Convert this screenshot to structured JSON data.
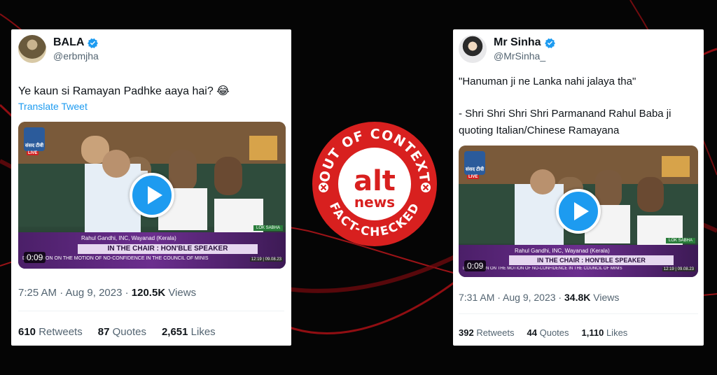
{
  "colors": {
    "twitter_blue": "#1d9bf0",
    "badge_red": "#d8201f",
    "background": "#050505"
  },
  "tweet_left": {
    "display_name": "BALA",
    "handle": "@erbmjha",
    "verified": true,
    "text": "Ye kaun si Ramayan Padhke aaya hai? 😂",
    "translate": "Translate Tweet",
    "video": {
      "duration": "0:09",
      "lower_third_name": "Rahul Gandhi, INC, Wayanad (Kerala)",
      "lower_third_chair": "IN THE CHAIR : HON'BLE SPEAKER",
      "lower_third_discussion": "DISCUSSION ON THE MOTION OF NO-CONFIDENCE IN THE COUNCIL OF MINIS",
      "tag": "LOK SABHA",
      "timestamp": "12:19 | 09.08.23",
      "channel": "संसद टीवी",
      "live": "LIVE"
    },
    "time": "7:25 AM · Aug 9, 2023 · ",
    "views_count": "120.5K",
    "views_label": " Views",
    "retweets_count": "610",
    "retweets_label": " Retweets",
    "quotes_count": "87",
    "quotes_label": " Quotes",
    "likes_count": "2,651",
    "likes_label": " Likes"
  },
  "tweet_right": {
    "display_name": "Mr Sinha",
    "handle": "@MrSinha_",
    "verified": true,
    "text_line1": "\"Hanuman ji ne Lanka nahi jalaya tha\"",
    "text_line2": "- Shri Shri Shri Shri Parmanand Rahul Baba ji",
    "text_line3": "quoting Italian/Chinese Ramayana",
    "video": {
      "duration": "0:09",
      "lower_third_name": "Rahul Gandhi, INC, Wayanad (Kerala)",
      "lower_third_chair": "IN THE CHAIR : HON'BLE SPEAKER",
      "lower_third_discussion": "DISCUSSION ON THE MOTION OF NO-CONFIDENCE IN THE COUNCIL OF MINIS",
      "tag": "LOK SABHA",
      "timestamp": "12:19 | 09.08.23",
      "channel": "संसद टीवी",
      "live": "LIVE"
    },
    "time": "7:31 AM · Aug 9, 2023 · ",
    "views_count": "34.8K",
    "views_label": " Views",
    "retweets_count": "392",
    "retweets_label": " Retweets",
    "quotes_count": "44",
    "quotes_label": " Quotes",
    "likes_count": "1,110",
    "likes_label": " Likes"
  },
  "badge": {
    "top_text": "OUT OF CONTEXT",
    "bottom_text": "FACT-CHECKED",
    "logo_top": "alt",
    "logo_bottom": "news"
  }
}
